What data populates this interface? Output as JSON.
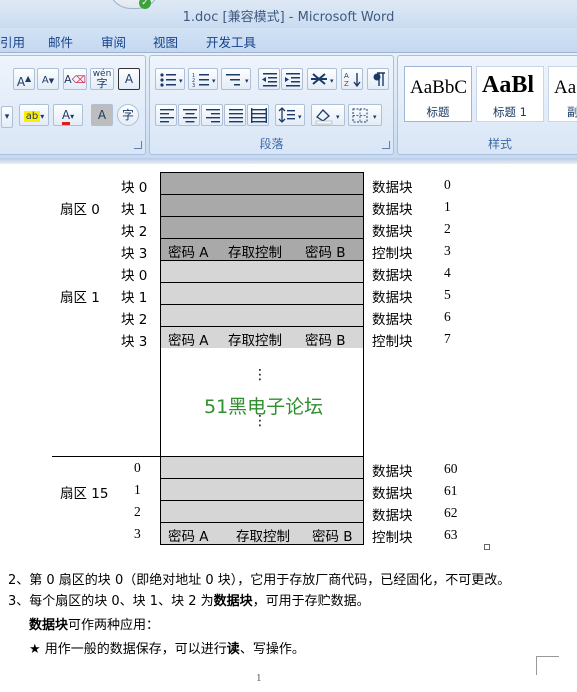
{
  "window": {
    "title": "1.doc [兼容模式] - Microsoft Word"
  },
  "tabs": [
    "引用",
    "邮件",
    "审阅",
    "视图",
    "开发工具"
  ],
  "ribbon": {
    "paragraph_group_label": "段落",
    "styles_group_label": "样式",
    "styles": [
      {
        "sample": "AaBbC",
        "name": "标题"
      },
      {
        "sample": "AaBl",
        "name": "标题 1"
      },
      {
        "sample": "Aa",
        "name": "副"
      }
    ],
    "font_buttons": [
      "A",
      "A",
      "A",
      "wén",
      "A",
      "A",
      "A",
      "字"
    ]
  },
  "diagram": {
    "rows": [
      {
        "block": "块 0",
        "right": "数据块",
        "addr": "0",
        "shade": "dark"
      },
      {
        "block": "块 1",
        "right": "数据块",
        "addr": "1",
        "shade": "dark"
      },
      {
        "block": "块 2",
        "right": "数据块",
        "addr": "2",
        "shade": "dark"
      },
      {
        "block": "块 3",
        "right": "控制块",
        "addr": "3",
        "shade": "dark"
      },
      {
        "block": "块 0",
        "right": "数据块",
        "addr": "4",
        "shade": "light"
      },
      {
        "block": "块 1",
        "right": "数据块",
        "addr": "5",
        "shade": "light"
      },
      {
        "block": "块 2",
        "right": "数据块",
        "addr": "6",
        "shade": "light"
      },
      {
        "block": "块 3",
        "right": "控制块",
        "addr": "7",
        "shade": "light"
      },
      {
        "block": "0",
        "right": "数据块",
        "addr": "60",
        "shade": "light"
      },
      {
        "block": "1",
        "right": "数据块",
        "addr": "61",
        "shade": "light"
      },
      {
        "block": "2",
        "right": "数据块",
        "addr": "62",
        "shade": "light"
      },
      {
        "block": "3",
        "right": "控制块",
        "addr": "63",
        "shade": "light"
      }
    ],
    "sectors": [
      "扇区 0",
      "扇区 1",
      "扇区 15"
    ],
    "control_cells": [
      [
        "密码 A",
        "存取控制",
        "密码 B"
      ],
      [
        "密码 A",
        "存取控制",
        "密码 B"
      ],
      [
        "密码 A",
        "存取控制",
        "密码 B"
      ]
    ],
    "watermark": "51黑电子论坛",
    "ellipsis": "⋮"
  },
  "paragraphs": {
    "p2": "2、第 0 扇区的块 0（即绝对地址 0 块），它用于存放厂商代码，已经固化，不可更改。",
    "p3_before": "3、每个扇区的块 0、块 1、块 2 为",
    "p3_bold": "数据块",
    "p3_after": "，可用于存贮数据。",
    "p4_bold": "数据块",
    "p4_after": "可作两种应用：",
    "p5_star": "★",
    "p5_before": " 用作一般的数据保存，可以进行",
    "p5_bold": "读",
    "p5_after": "、写操作。"
  },
  "page_number": "1",
  "colors": {
    "ribbon_text": "#15428b",
    "watermark": "#2f8f2f"
  }
}
